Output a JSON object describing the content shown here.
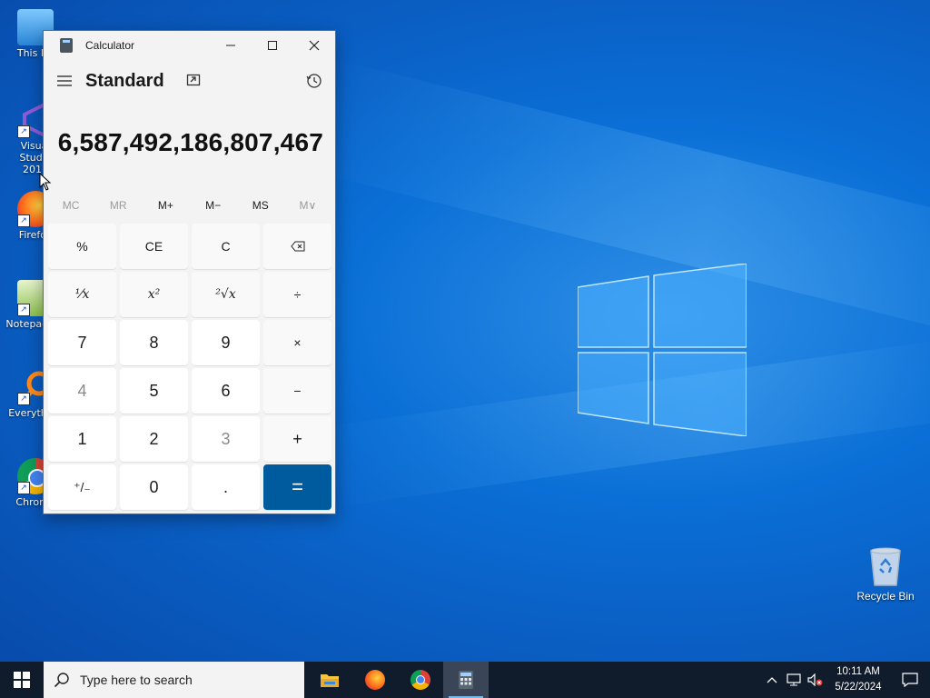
{
  "desktop": {
    "icons": [
      {
        "label": "This PC"
      },
      {
        "label": "Visual Studio 2017"
      },
      {
        "label": "Firefox"
      },
      {
        "label": "Notepad++"
      },
      {
        "label": "Everything"
      },
      {
        "label": "Chrome"
      }
    ],
    "recycle_bin": {
      "label": "Recycle Bin"
    }
  },
  "calculator": {
    "window_title": "Calculator",
    "mode": "Standard",
    "display_value": "6,587,492,186,807,467",
    "memory": [
      "MC",
      "MR",
      "M+",
      "M−",
      "MS",
      "M∨"
    ],
    "memory_disabled": [
      "MC",
      "MR",
      "M∨"
    ],
    "keys": [
      [
        "%",
        "CE",
        "C",
        "⌫"
      ],
      [
        "⅟x",
        "x²",
        "²√x",
        "÷"
      ],
      [
        "7",
        "8",
        "9",
        "×"
      ],
      [
        "4",
        "5",
        "6",
        "−"
      ],
      [
        "1",
        "2",
        "3",
        "+"
      ],
      [
        "⁺/₋",
        "0",
        ".",
        "="
      ]
    ],
    "accent_color": "#005a9e"
  },
  "taskbar": {
    "search_placeholder": "Type here to search",
    "apps": [
      "file-explorer",
      "firefox",
      "chrome",
      "calculator"
    ],
    "active_app": "calculator",
    "clock_time": "10:11 AM",
    "clock_date": "5/22/2024"
  }
}
